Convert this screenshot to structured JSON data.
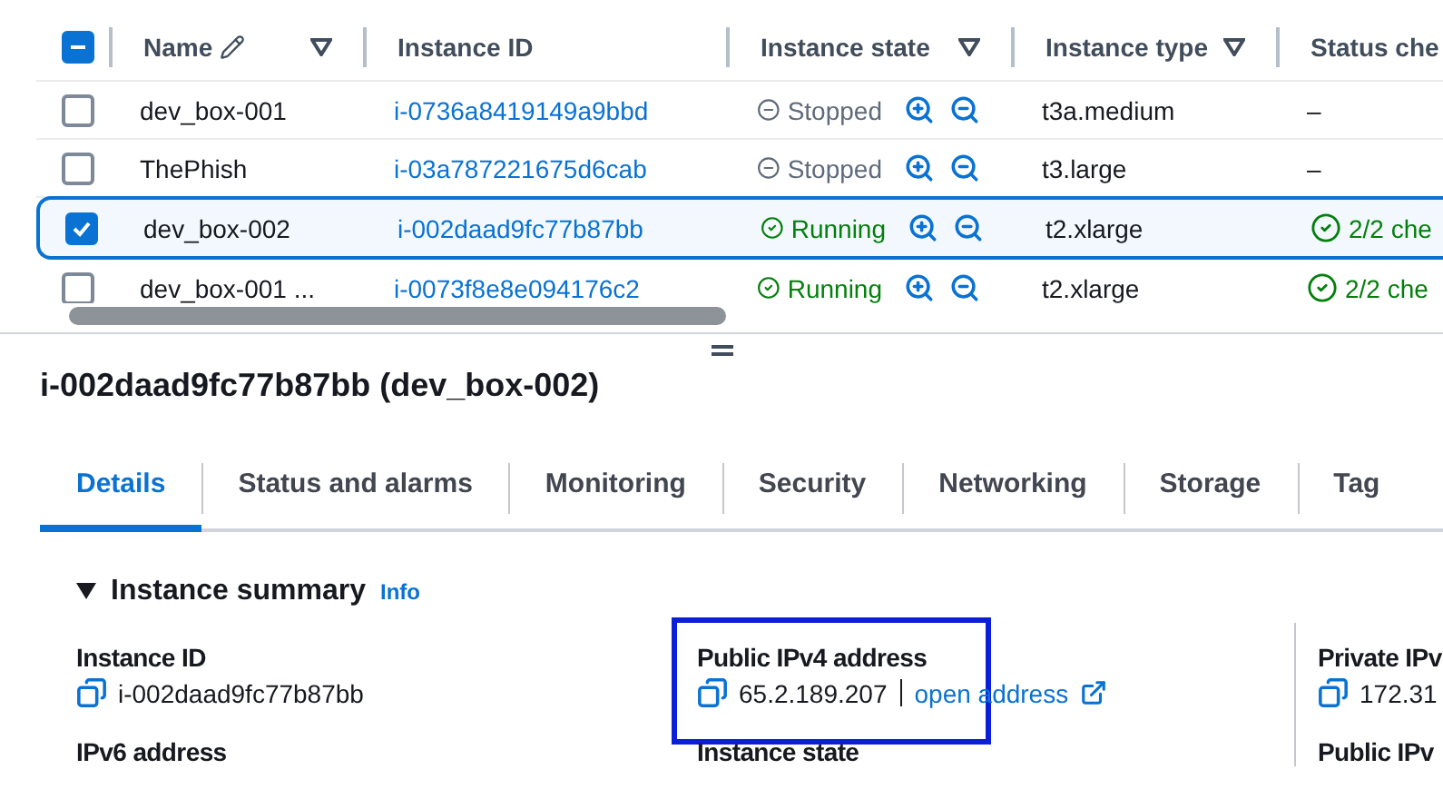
{
  "table": {
    "select_all": {
      "indeterminate": true
    },
    "columns": [
      {
        "label": "Name",
        "editable": true,
        "filter": true
      },
      {
        "label": "Instance ID",
        "editable": false,
        "filter": false
      },
      {
        "label": "Instance state",
        "filter": true
      },
      {
        "label": "Instance type",
        "filter": true
      },
      {
        "label": "Status che",
        "filter": false
      }
    ],
    "rows": [
      {
        "name": "dev_box-001",
        "instance_id": "i-0736a8419149a9bbd",
        "state": {
          "kind": "stopped",
          "text": "Stopped"
        },
        "type": "t3a.medium",
        "status_check": {
          "passed": false,
          "text": "–"
        },
        "selected": false
      },
      {
        "name": "ThePhish",
        "instance_id": "i-03a787221675d6cab",
        "state": {
          "kind": "stopped",
          "text": "Stopped"
        },
        "type": "t3.large",
        "status_check": {
          "passed": false,
          "text": "–"
        },
        "selected": false
      },
      {
        "name": "dev_box-002",
        "instance_id": "i-002daad9fc77b87bb",
        "state": {
          "kind": "running",
          "text": "Running"
        },
        "type": "t2.xlarge",
        "status_check": {
          "passed": true,
          "text": "2/2 che"
        },
        "selected": true
      },
      {
        "name": "dev_box-001 ...",
        "instance_id": "i-0073f8e8e094176c2",
        "state": {
          "kind": "running",
          "text": "Running"
        },
        "type": "t2.xlarge",
        "status_check": {
          "passed": true,
          "text": "2/2 che"
        },
        "selected": false
      }
    ]
  },
  "detail": {
    "title": "i-002daad9fc77b87bb (dev_box-002)",
    "tabs": [
      {
        "label": "Details",
        "selected": true
      },
      {
        "label": "Status and alarms",
        "selected": false
      },
      {
        "label": "Monitoring",
        "selected": false
      },
      {
        "label": "Security",
        "selected": false
      },
      {
        "label": "Networking",
        "selected": false
      },
      {
        "label": "Storage",
        "selected": false
      },
      {
        "label": "Tag",
        "selected": false
      }
    ],
    "summary": {
      "title": "Instance summary",
      "info": "Info",
      "expanded": true,
      "columns": [
        [
          {
            "label": "Instance ID",
            "value": "i-002daad9fc77b87bb",
            "copyable": true
          },
          {
            "label": "IPv6 address"
          }
        ],
        [
          {
            "label": "Public IPv4 address",
            "value": "65.2.189.207",
            "link": "open address",
            "copyable": true,
            "highlighted": true
          },
          {
            "label": "Instance state"
          }
        ],
        [
          {
            "label": "Private IPv",
            "value": "172.31",
            "copyable": true
          },
          {
            "label": "Public IPv"
          }
        ]
      ]
    }
  }
}
